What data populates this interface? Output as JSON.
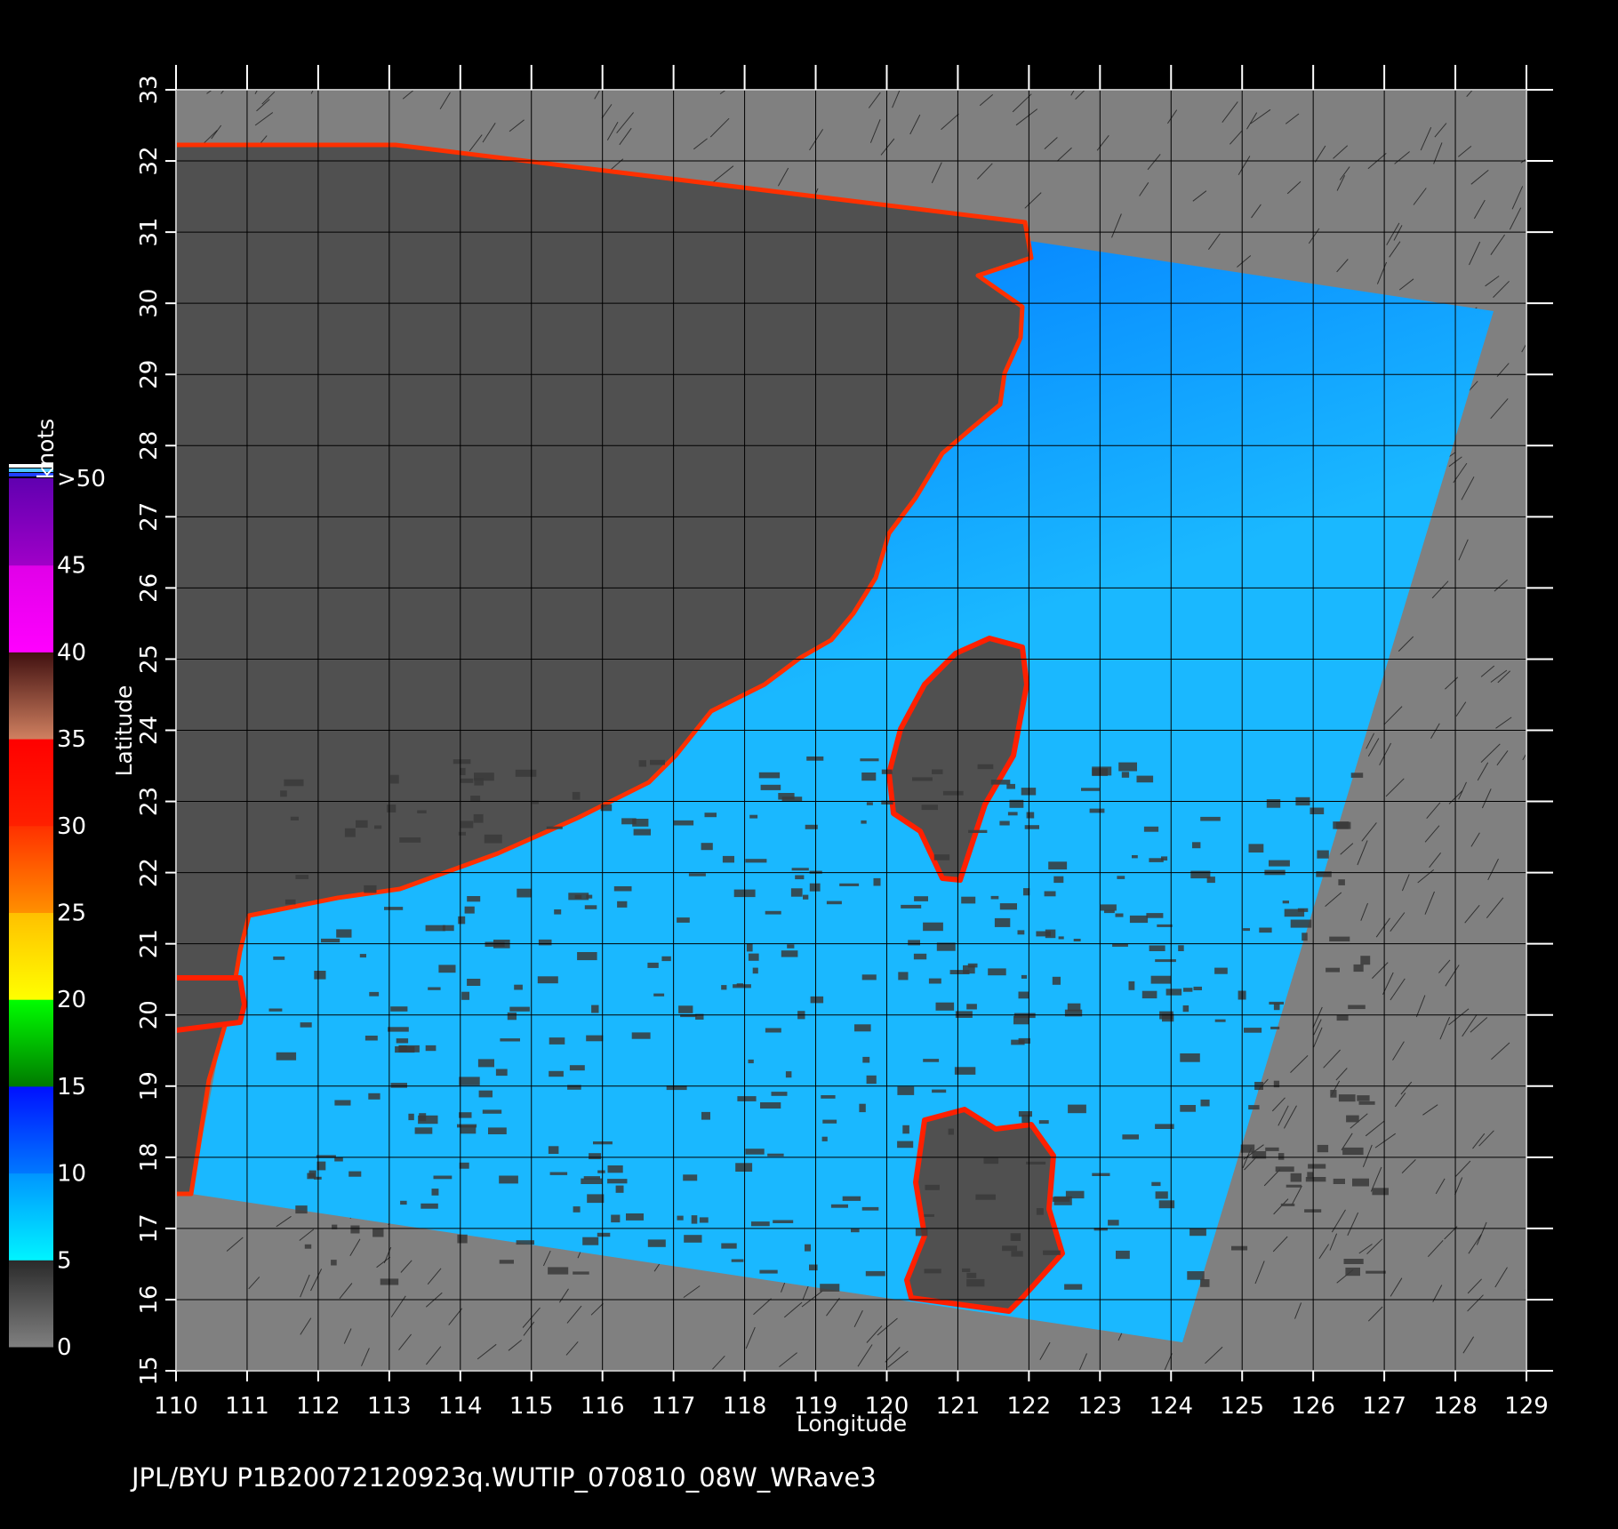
{
  "chart_data": {
    "type": "heatmap",
    "title": "",
    "xlabel": "Longitude",
    "ylabel": "Latitude",
    "xlim": [
      110,
      129
    ],
    "ylim": [
      15,
      33
    ],
    "x_ticks": [
      "110",
      "111",
      "112",
      "113",
      "114",
      "115",
      "116",
      "117",
      "118",
      "119",
      "120",
      "121",
      "122",
      "123",
      "124",
      "125",
      "126",
      "127",
      "128",
      "129"
    ],
    "y_ticks": [
      "15",
      "16",
      "17",
      "18",
      "19",
      "20",
      "21",
      "22",
      "23",
      "24",
      "25",
      "26",
      "27",
      "28",
      "29",
      "30",
      "31",
      "32",
      "33"
    ],
    "grid": true,
    "colorbar": {
      "label": "knots",
      "tick_labels": [
        "0",
        "5",
        "10",
        "15",
        "20",
        "25",
        "30",
        "35",
        "40",
        "45",
        ">50"
      ],
      "segments": [
        {
          "from": 0,
          "to": 5,
          "colors": [
            "#808080",
            "#2a2a2a"
          ]
        },
        {
          "from": 5,
          "to": 10,
          "colors": [
            "#00f4ff",
            "#0095ff"
          ]
        },
        {
          "from": 10,
          "to": 15,
          "colors": [
            "#0078ff",
            "#0010ff"
          ]
        },
        {
          "from": 15,
          "to": 20,
          "colors": [
            "#007a00",
            "#00ff00"
          ]
        },
        {
          "from": 20,
          "to": 25,
          "colors": [
            "#ffff00",
            "#ffc000"
          ]
        },
        {
          "from": 25,
          "to": 30,
          "colors": [
            "#ff9000",
            "#ff3000"
          ]
        },
        {
          "from": 30,
          "to": 35,
          "colors": [
            "#ff2000",
            "#ff0000"
          ]
        },
        {
          "from": 35,
          "to": 40,
          "colors": [
            "#d08060",
            "#401010"
          ]
        },
        {
          "from": 40,
          "to": 45,
          "colors": [
            "#ff00ff",
            "#e000e8"
          ]
        },
        {
          "from": 45,
          "to": 50,
          "colors": [
            "#a000c8",
            "#6000b0"
          ]
        }
      ]
    },
    "colors": {
      "no_data": "#808080",
      "land": "#505050",
      "ocean_typical": "#1ab8ff",
      "coast_high_wind": "#ff2000",
      "north_high_wind": "#00d800"
    }
  },
  "footer": {
    "text": "JPL/BYU  P1B20072120923q.WUTIP_070810_08W_WRave3"
  }
}
